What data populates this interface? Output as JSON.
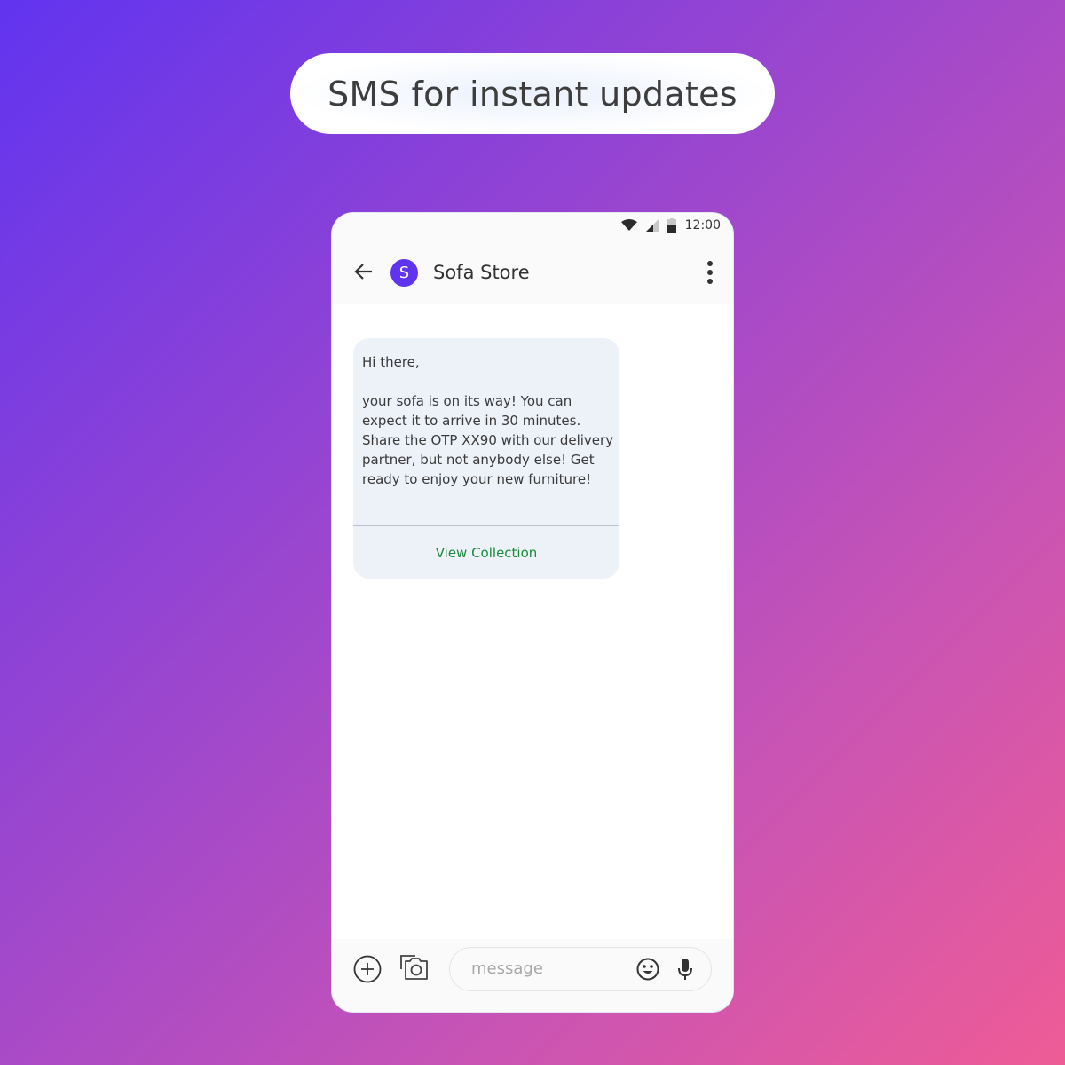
{
  "banner": {
    "text": "SMS for instant updates"
  },
  "colors": {
    "gradient_start": "#6134ef",
    "gradient_end": "#ee5c96",
    "avatar_bg": "#5f34ef",
    "action_text": "#1b8a3b",
    "bubble_bg": "#edf1f8"
  },
  "statusbar": {
    "icons": [
      "wifi-icon",
      "signal-icon",
      "battery-icon"
    ],
    "time": "12:00"
  },
  "appbar": {
    "back_icon": "arrow-left-icon",
    "avatar_letter": "S",
    "title": "Sofa Store",
    "menu_icon": "more-vert-icon"
  },
  "message": {
    "text": "Hi there,\n\nyour sofa is on its way! You can expect it to arrive in 30 minutes. Share the OTP XX90 with our delivery partner, but not anybody else! Get ready to enjoy your new furniture!",
    "action_label": "View Collection"
  },
  "composer": {
    "add_icon": "add-circle-icon",
    "gallery_icon": "camera-gallery-icon",
    "placeholder": "message",
    "emoji_icon": "emoji-icon",
    "mic_icon": "mic-icon"
  }
}
